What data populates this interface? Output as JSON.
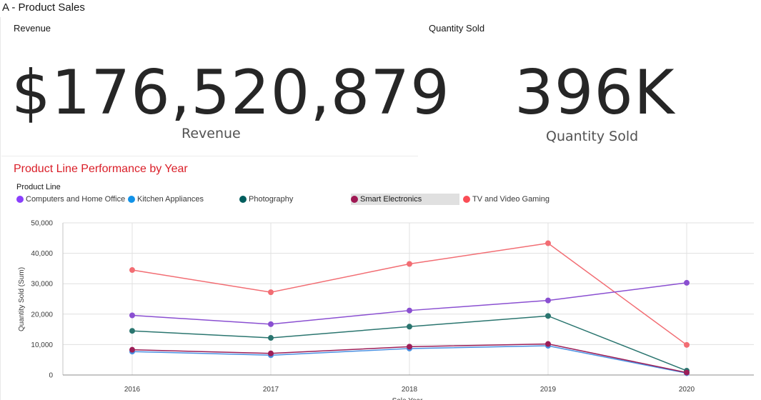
{
  "dashboard": {
    "title": "A - Product Sales"
  },
  "kpis": [
    {
      "label": "Revenue",
      "value": "$176,520,879",
      "sublabel": "Revenue"
    },
    {
      "label": "Quantity Sold",
      "value": "396K",
      "sublabel": "Quantity Sold"
    }
  ],
  "legend": {
    "title": "Product Line",
    "selected": "Smart Electronics",
    "items": [
      {
        "label": "Computers and Home Office",
        "color": "#8a3ffc"
      },
      {
        "label": "Kitchen Appliances",
        "color": "#1192e8"
      },
      {
        "label": "Photography",
        "color": "#005d5d"
      },
      {
        "label": "Smart Electronics",
        "color": "#9f1853"
      },
      {
        "label": "TV and Video Gaming",
        "color": "#fa4d56"
      }
    ]
  },
  "chart_data": {
    "type": "line",
    "title": "Product Line Performance by Year",
    "xlabel": "Sale Year",
    "ylabel": "Quantity Sold (Sum)",
    "x": [
      "2016",
      "2017",
      "2018",
      "2019",
      "2020"
    ],
    "ylim": [
      0,
      50000
    ],
    "yticks": [
      "0",
      "10,000",
      "20,000",
      "30,000",
      "40,000",
      "50,000"
    ],
    "grid": true,
    "legend_position": "top",
    "series": [
      {
        "name": "TV and Video Gaming",
        "color": "#f26d73",
        "values": [
          34500,
          27200,
          36500,
          43300,
          9900
        ]
      },
      {
        "name": "Computers and Home Office",
        "color": "#8a4fd1",
        "values": [
          19600,
          16700,
          21200,
          24500,
          30300
        ]
      },
      {
        "name": "Photography",
        "color": "#2a756f",
        "values": [
          14500,
          12200,
          15900,
          19400,
          1400
        ]
      },
      {
        "name": "Kitchen Appliances",
        "color": "#4a90e2",
        "values": [
          7700,
          6500,
          8700,
          9600,
          600
        ]
      },
      {
        "name": "Smart Electronics",
        "color": "#9c1e58",
        "values": [
          8300,
          7100,
          9300,
          10200,
          800
        ]
      }
    ]
  }
}
